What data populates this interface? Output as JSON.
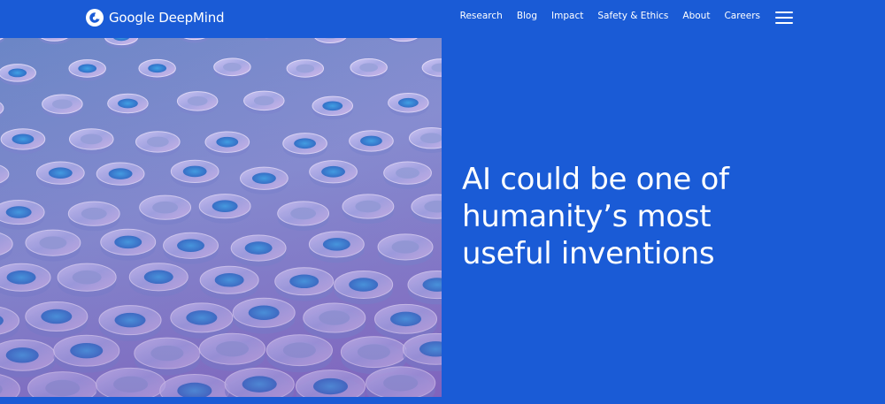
{
  "brand": {
    "name": "Google DeepMind",
    "logo_icon": "deepmind-logo-icon"
  },
  "nav": {
    "links": [
      "Research",
      "Blog",
      "Impact",
      "Safety & Ethics",
      "About",
      "Careers"
    ],
    "menu_icon": "hamburger-menu-icon"
  },
  "hero": {
    "headline_lines": [
      "AI could be one of",
      "humanity’s most",
      "useful inventions"
    ],
    "image_subject": "glass-discs-artwork"
  },
  "colors": {
    "background": "#1a5bd6",
    "text": "#ffffff",
    "image_tint": "#8b8fd2"
  }
}
